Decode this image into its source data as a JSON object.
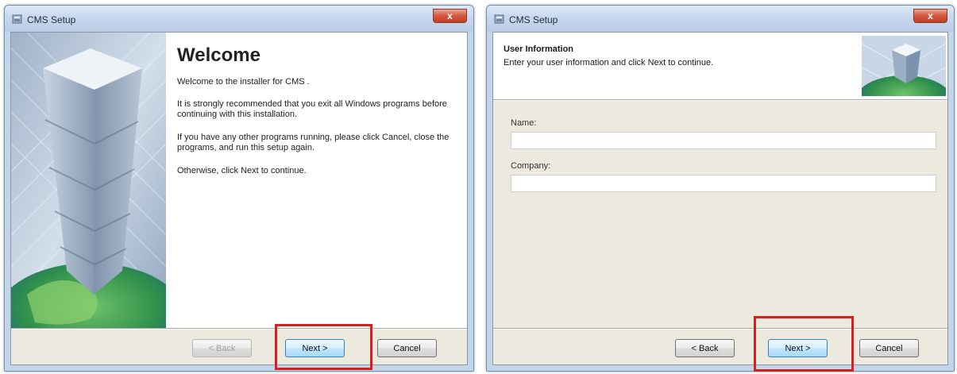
{
  "screens": [
    {
      "window_title": "CMS Setup",
      "heading": "Welcome",
      "paragraphs": [
        "Welcome to the installer for CMS .",
        "It is strongly recommended that you exit all Windows programs before continuing with this installation.",
        "If you have any other programs running, please click Cancel, close the programs, and run this setup again.",
        "Otherwise, click Next to continue."
      ],
      "buttons": {
        "back": "< Back",
        "next": "Next >",
        "cancel": "Cancel"
      },
      "back_enabled": false
    },
    {
      "window_title": "CMS Setup",
      "heading": "User Information",
      "subheading": "Enter your user information and click Next to continue.",
      "fields": [
        {
          "label": "Name:",
          "value": ""
        },
        {
          "label": "Company:",
          "value": ""
        }
      ],
      "buttons": {
        "back": "< Back",
        "next": "Next >",
        "cancel": "Cancel"
      },
      "back_enabled": true
    }
  ],
  "close_glyph": "x",
  "colors": {
    "highlight": "#d62020",
    "dialog_face": "#ece9df",
    "titlebar": "#c4d6ec",
    "close_button": "#d4583e"
  },
  "icons": [
    "setup-app-icon",
    "close-icon",
    "tower-graphic",
    "globe-graphic"
  ]
}
